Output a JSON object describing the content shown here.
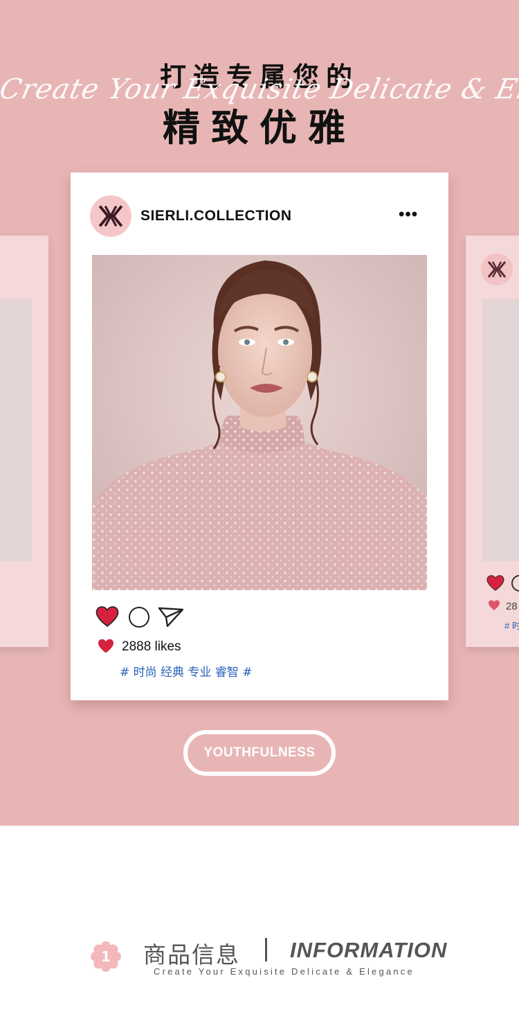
{
  "hero": {
    "title_top": "打造专属您的",
    "script_text": "Create Your Exquisite Delicate & Elegance",
    "title_main": "精致优雅"
  },
  "post": {
    "username": "SIERLI.COLLECTION",
    "more": "•••",
    "likes": "2888 likes",
    "tags": "# 时尚 经典 专业 睿智 #"
  },
  "side_post": {
    "likes_partial": "28",
    "tags_partial": "# 时"
  },
  "pill_label": "YOUTHFULNESS",
  "info": {
    "badge_number": "1",
    "cn_title": "商品信息",
    "en_title": "INFORMATION",
    "subtitle": "Create Your Exquisite Delicate & Elegance"
  },
  "colors": {
    "hero_bg": "#e8b5b5",
    "card_bg": "#ffffff",
    "heart_red": "#d6223f",
    "tag_blue": "#2a62b8",
    "badge_pink": "#f2b8ba"
  },
  "icons": [
    "logo-icon",
    "more-icon",
    "heart-icon",
    "comment-icon",
    "share-icon",
    "flower-badge-icon"
  ]
}
